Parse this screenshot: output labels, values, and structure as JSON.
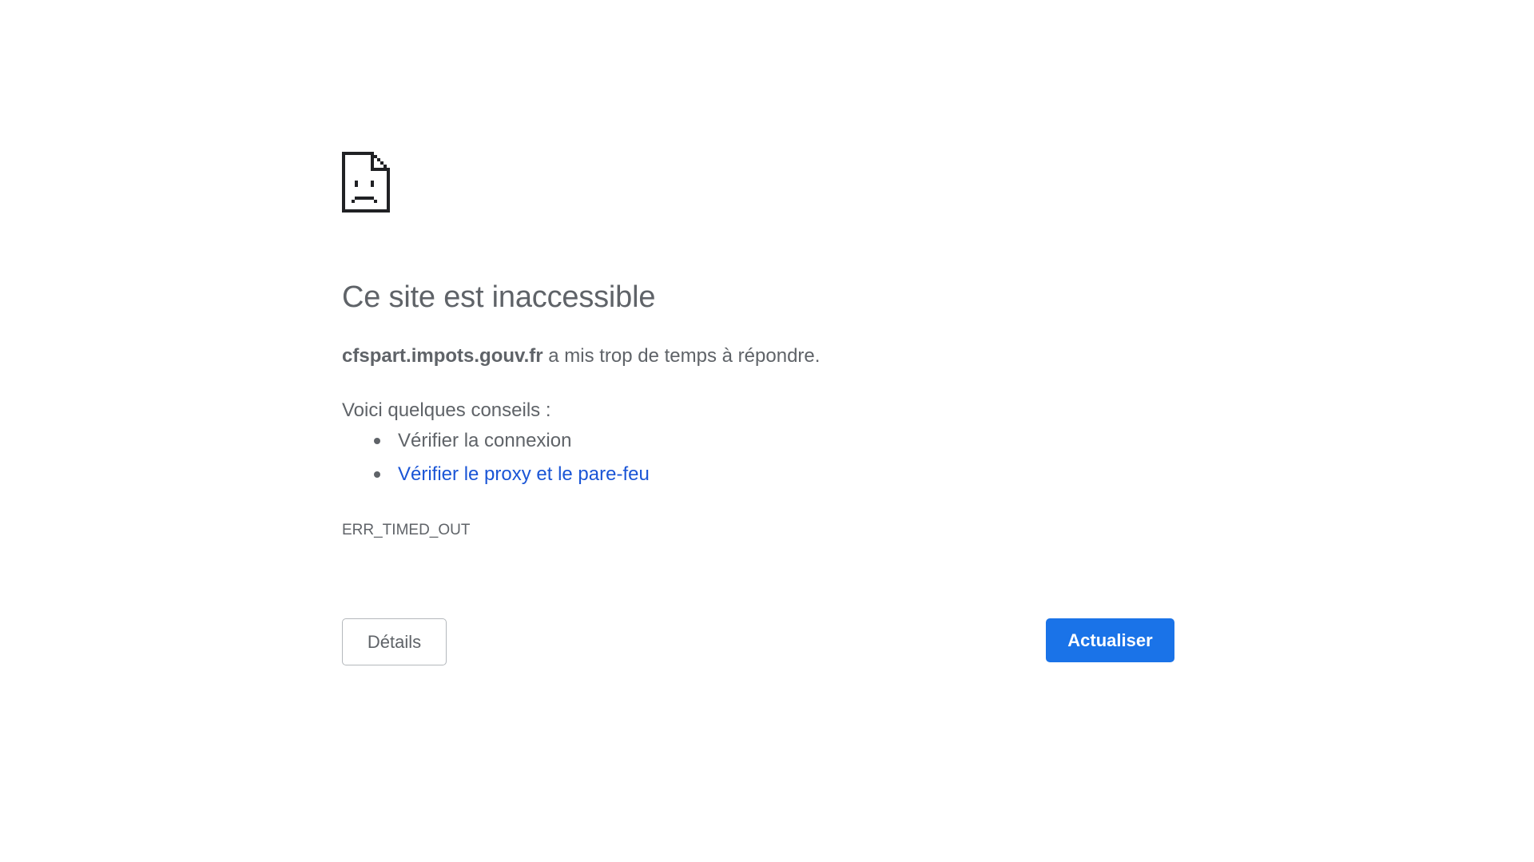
{
  "error_page": {
    "icon": "sad-document-icon",
    "heading": "Ce site est inaccessible",
    "summary": {
      "host": "cfspart.impots.gouv.fr",
      "message": " a mis trop de temps à répondre."
    },
    "suggestions_intro": "Voici quelques conseils :",
    "suggestions": [
      {
        "label": "Vérifier la connexion",
        "is_link": false
      },
      {
        "label": "Vérifier le proxy et le pare-feu",
        "is_link": true
      }
    ],
    "error_code": "ERR_TIMED_OUT",
    "details_label": "Détails",
    "reload_label": "Actualiser"
  },
  "colors": {
    "text": "#5f6368",
    "link": "#1a55d6",
    "primary_button": "#1a73e8",
    "button_border": "#b4b8bc",
    "background": "#ffffff"
  }
}
